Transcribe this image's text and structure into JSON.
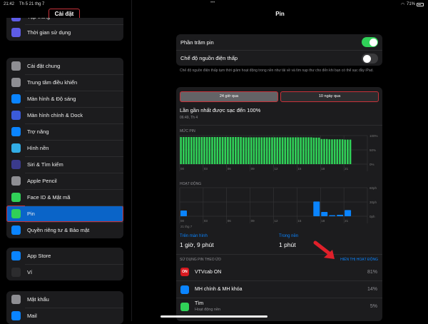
{
  "status_bar": {
    "time": "21:42",
    "date": "Th 5 21 thg 7",
    "battery": "71%"
  },
  "sidebar": {
    "title": "Cài đặt",
    "groups": [
      {
        "items": [
          {
            "label": "Tập trung",
            "icon": "moon-icon",
            "color": "#5e5ce6"
          },
          {
            "label": "Thời gian sử dụng",
            "icon": "hourglass-icon",
            "color": "#5e5ce6"
          }
        ]
      },
      {
        "items": [
          {
            "label": "Cài đặt chung",
            "icon": "gear-icon",
            "color": "#8e8e93"
          },
          {
            "label": "Trung tâm điều khiển",
            "icon": "switches-icon",
            "color": "#8e8e93"
          },
          {
            "label": "Màn hình & Độ sáng",
            "icon": "text-size-icon",
            "color": "#0a84ff"
          },
          {
            "label": "Màn hình chính & Dock",
            "icon": "grid-icon",
            "color": "#3b5bdb"
          },
          {
            "label": "Trợ năng",
            "icon": "accessibility-icon",
            "color": "#0a84ff"
          },
          {
            "label": "Hình nền",
            "icon": "flower-icon",
            "color": "#32ade6"
          },
          {
            "label": "Siri & Tìm kiếm",
            "icon": "siri-icon",
            "color": "#3a3a8c"
          },
          {
            "label": "Apple Pencil",
            "icon": "pencil-icon",
            "color": "#8e8e93"
          },
          {
            "label": "Face ID & Mật mã",
            "icon": "face-id-icon",
            "color": "#30d158"
          },
          {
            "label": "Pin",
            "icon": "battery-icon",
            "color": "#30d158",
            "selected": true
          },
          {
            "label": "Quyền riêng tư & Bảo mật",
            "icon": "hand-icon",
            "color": "#0a84ff"
          }
        ]
      },
      {
        "items": [
          {
            "label": "App Store",
            "icon": "app-store-icon",
            "color": "#0a84ff"
          },
          {
            "label": "Ví",
            "icon": "wallet-icon",
            "color": "#2c2c2e"
          }
        ]
      },
      {
        "items": [
          {
            "label": "Mật khẩu",
            "icon": "key-icon",
            "color": "#8e8e93"
          },
          {
            "label": "Mail",
            "icon": "mail-icon",
            "color": "#0a84ff"
          }
        ]
      }
    ]
  },
  "main": {
    "title": "Pin",
    "battery_percentage": {
      "label": "Phần trăm pin",
      "on": true
    },
    "low_power": {
      "label": "Chế độ nguồn điện thấp",
      "on": false
    },
    "low_power_note": "Chế độ nguồn điện thấp tạm thời giảm hoạt động trong nền như tải về và tìm nạp thư cho đến khi bạn có thể sạc đầy iPad.",
    "tabs": [
      {
        "label": "24 giờ qua",
        "selected": true
      },
      {
        "label": "10 ngày qua",
        "selected": false
      }
    ],
    "last_charged": {
      "title": "Lần gần nhất được sạc đến 100%",
      "time": "06:49, Th 4"
    },
    "battery_chart_label": "MỨC PIN",
    "activity_chart_label": "HOẠT ĐỘNG",
    "date_label": "21 thg 7",
    "on_screen": {
      "label": "Trên màn hình",
      "value": "1 giờ, 9 phút"
    },
    "background": {
      "label": "Trong nền",
      "value": "1 phút"
    },
    "usage_header": "SỬ DỤNG PIN THEO ỨD",
    "show_activity": "HIỂN THỊ HOẠT ĐỘNG",
    "apps": [
      {
        "name": "VTVcab ON",
        "sub": "",
        "percent": "81%",
        "icon": "vtvcab-icon",
        "icon_text": "ON",
        "color": "#d71920"
      },
      {
        "name": "MH chính & MH khóa",
        "sub": "",
        "percent": "14%",
        "icon": "home-screen-icon",
        "icon_text": "",
        "color": "#0a84ff"
      },
      {
        "name": "Tìm",
        "sub": "Hoạt động nền",
        "percent": "5%",
        "icon": "find-my-icon",
        "icon_text": "",
        "color": "#30d158"
      }
    ]
  },
  "chart_data": [
    {
      "type": "bar",
      "title": "MỨC PIN",
      "x_ticks": [
        "00",
        "03",
        "06",
        "09",
        "12",
        "15",
        "18",
        "21"
      ],
      "y_ticks": [
        "100%",
        "50%",
        "0%"
      ],
      "ylim": [
        0,
        100
      ],
      "hours": [
        0,
        1,
        2,
        3,
        4,
        5,
        6,
        7,
        8,
        9,
        10,
        11,
        12,
        13,
        14,
        15,
        16,
        17,
        18,
        19,
        20,
        21
      ],
      "values": [
        95,
        95,
        95,
        95,
        95,
        95,
        95,
        95,
        94,
        94,
        94,
        94,
        94,
        94,
        94,
        94,
        94,
        93,
        88,
        87,
        87,
        86
      ],
      "color": "#30d158"
    },
    {
      "type": "bar",
      "title": "HOẠT ĐỘNG",
      "x_ticks": [
        "00",
        "03",
        "06",
        "09",
        "12",
        "15",
        "18",
        "21"
      ],
      "y_ticks": [
        "60ph",
        "30ph",
        "0ph"
      ],
      "ylim": [
        0,
        60
      ],
      "hours": [
        0,
        17,
        18,
        19,
        20,
        21
      ],
      "values": [
        12,
        31,
        9,
        2,
        3,
        13
      ],
      "color": "#0a84ff"
    }
  ],
  "colors": {
    "accent": "#0a84ff",
    "selection": "#0a64c8",
    "annotation": "#c8323a",
    "toggle_on": "#30d158"
  }
}
